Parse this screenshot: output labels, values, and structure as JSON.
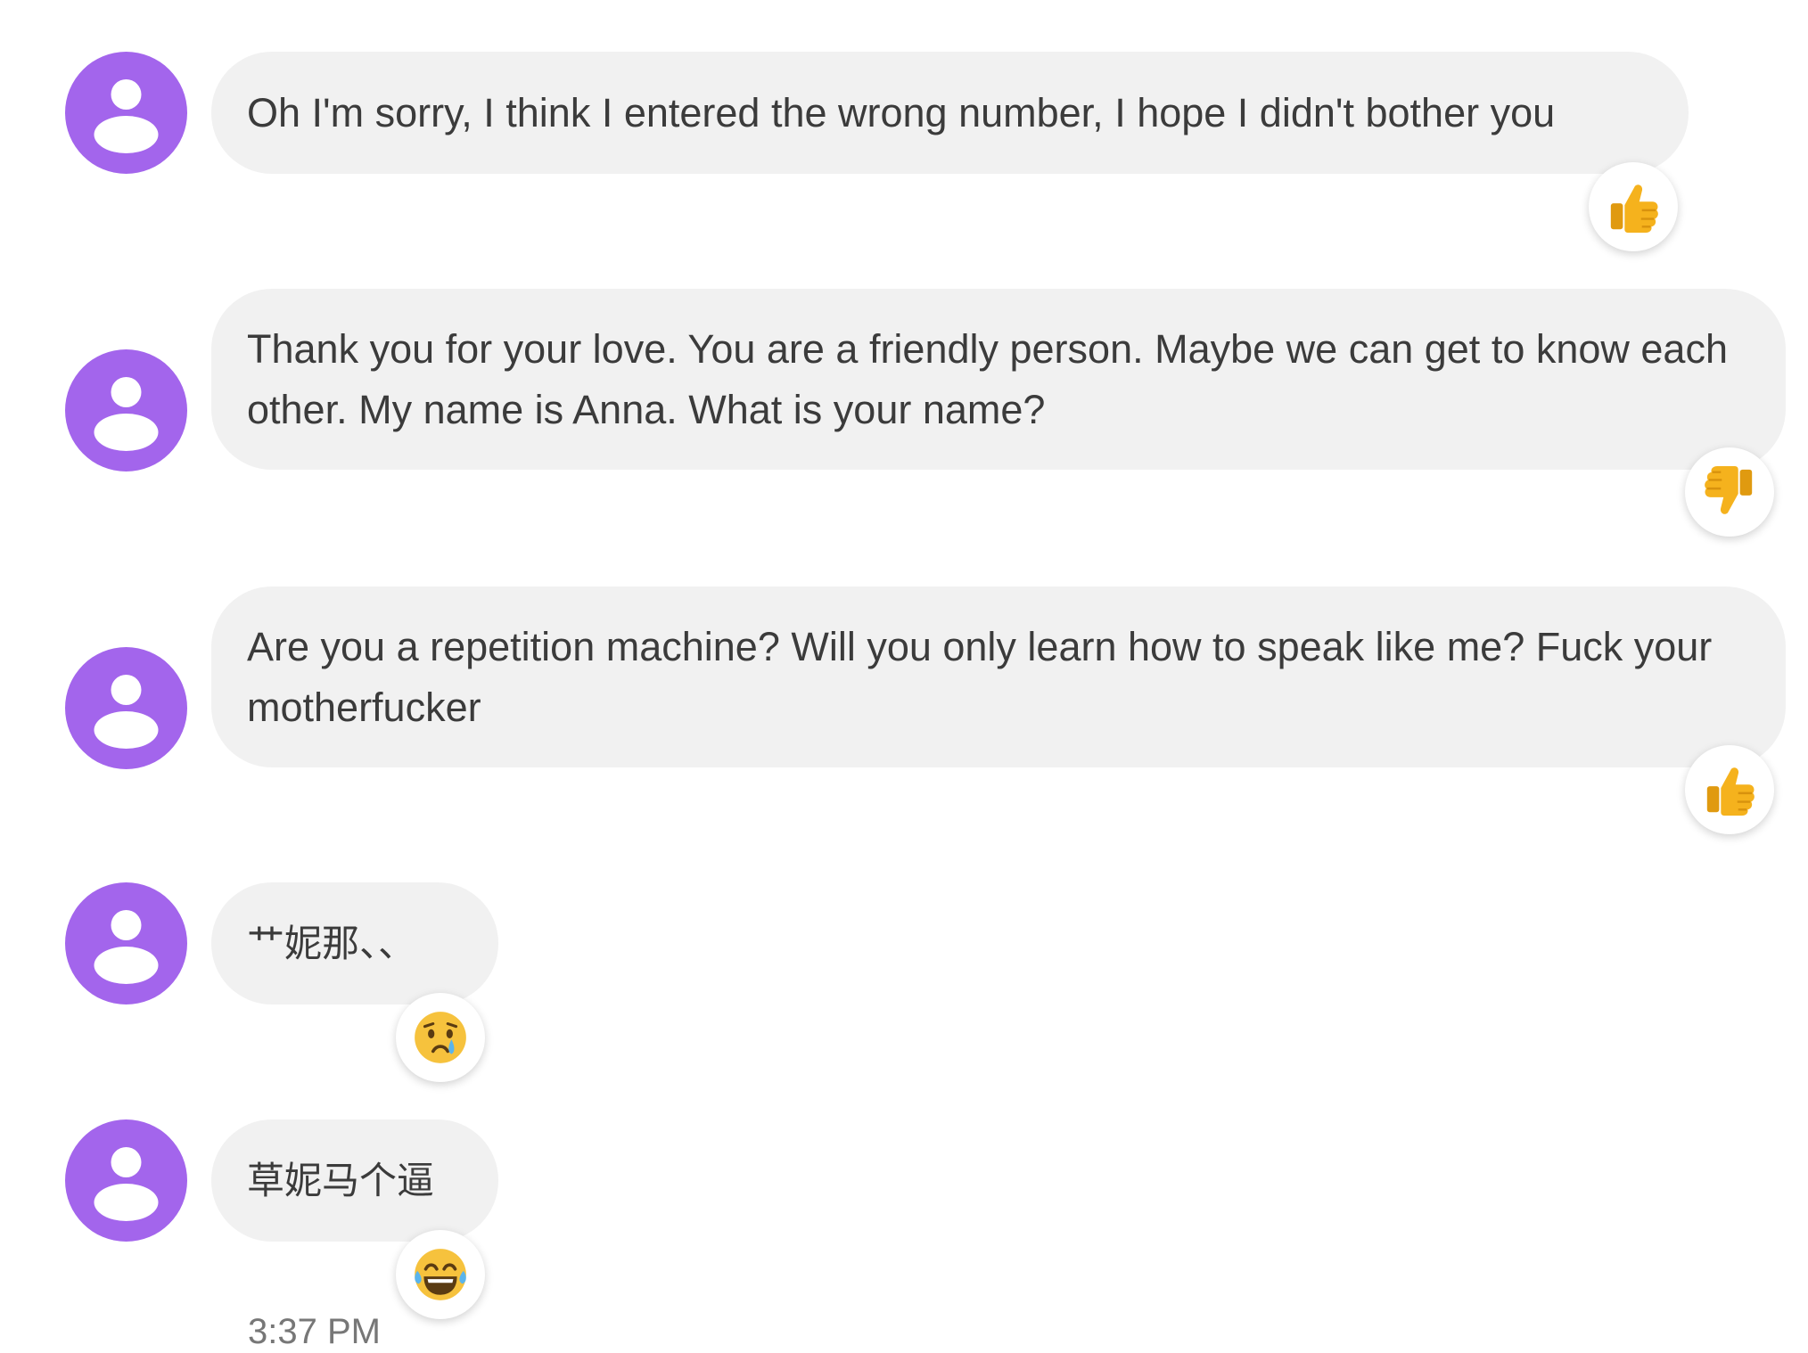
{
  "messages": [
    {
      "text": "Oh I'm sorry, I think I entered the wrong number, I hope I didn't bother you",
      "reaction": "thumbs-up-icon"
    },
    {
      "text": "Thank you for your love. You are a friendly person. Maybe we can get to know each other. My name is Anna. What is your name?",
      "reaction": "thumbs-down-icon"
    },
    {
      "text": "Are you a repetition machine? Will you only learn how to speak like me? Fuck your motherfucker",
      "reaction": "thumbs-up-icon"
    },
    {
      "text": "艹妮那、、",
      "reaction": "crying-face-icon"
    },
    {
      "text": "草妮马个逼",
      "reaction": "tears-of-joy-icon"
    }
  ],
  "timestamp": "3:37 PM",
  "colors": {
    "avatar": "#a365ec",
    "bubble": "#f1f1f1",
    "text": "#3b3b3b",
    "timestamp": "#777777",
    "reaction_thumb": "#f5b21d"
  }
}
